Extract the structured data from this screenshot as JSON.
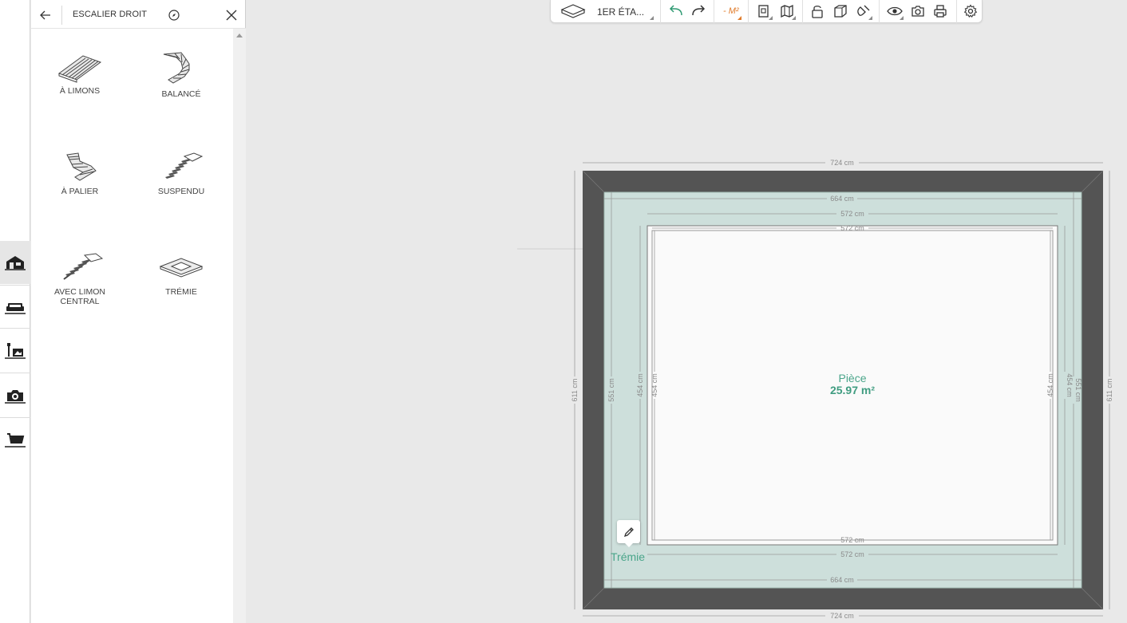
{
  "panel": {
    "title": "ESCALIER DROIT",
    "items": [
      {
        "label": "À LIMONS"
      },
      {
        "label": "BALANCÉ"
      },
      {
        "label": "À PALIER"
      },
      {
        "label": "SUSPENDU"
      },
      {
        "label": "AVEC LIMON CENTRAL"
      },
      {
        "label": "TRÉMIE"
      }
    ]
  },
  "rail": {
    "icons": [
      "house-icon",
      "sofa-icon",
      "decor-icon",
      "photo-camera-icon",
      "shopping-cart-icon"
    ],
    "active": "house-icon"
  },
  "toolbar": {
    "floor": "1ER ÉTA...",
    "m2": "- M²",
    "icons": [
      "floor-icon",
      "undo-icon",
      "redo-icon",
      "plan-2d-icon",
      "map-icon",
      "unlock-icon",
      "cube-3d-icon",
      "magnet-icon",
      "eye-icon",
      "camera-icon",
      "print-icon",
      "settings-icon"
    ]
  },
  "plan": {
    "room": {
      "name": "Pièce",
      "area": "25.97 m²"
    },
    "tremie_label": "Trémie",
    "dims": {
      "outer_w": "724 cm",
      "outer_h": "611 cm",
      "tremie_w": "664 cm",
      "tremie_h": "551 cm",
      "inner_w": "572 cm",
      "inner_h": "454 cm"
    }
  },
  "colors": {
    "wall": "#545454",
    "tremie": "#cddfdb",
    "room": "#fafafa",
    "accent": "#4aa58a",
    "m2": "#e07b2a"
  }
}
